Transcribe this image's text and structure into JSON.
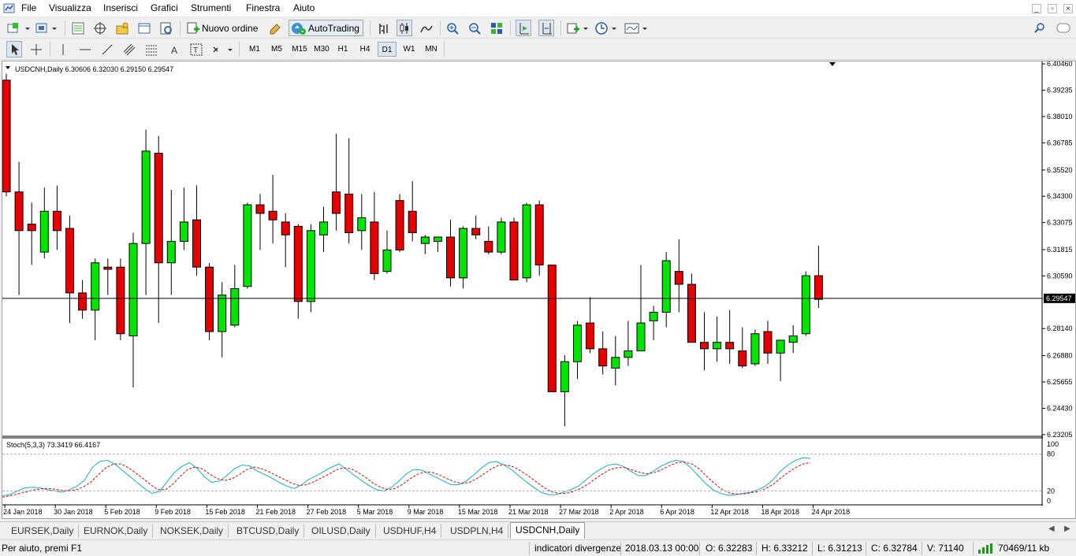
{
  "menu": [
    "File",
    "Visualizza",
    "Inserisci",
    "Grafici",
    "Strumenti",
    "Finestra",
    "Aiuto"
  ],
  "toolbar": {
    "new_order": "Nuovo ordine",
    "autotrading": "AutoTrading"
  },
  "timeframes": [
    "M1",
    "M5",
    "M15",
    "M30",
    "H1",
    "H4",
    "D1",
    "W1",
    "MN"
  ],
  "active_timeframe": "D1",
  "chart": {
    "header": "USDCNH,Daily  6.30606 6.32030 6.29150 6.29547",
    "price_labels": [
      "6.40460",
      "6.39235",
      "6.38010",
      "6.36785",
      "6.35520",
      "6.34300",
      "6.33075",
      "6.31815",
      "6.30590",
      "6.28140",
      "6.26880",
      "6.25655",
      "6.24430",
      "6.23205"
    ],
    "current_price": "6.29547",
    "indicator_header": "Stoch(5,3,3) 73.3419 66.4167",
    "indicator_levels": [
      "100",
      "80",
      "20",
      "0"
    ],
    "date_labels": [
      "24 Jan 2018",
      "30 Jan 2018",
      "5 Feb 2018",
      "9 Feb 2018",
      "15 Feb 2018",
      "21 Feb 2018",
      "27 Feb 2018",
      "5 Mar 2018",
      "9 Mar 2018",
      "15 Mar 2018",
      "21 Mar 2018",
      "27 Mar 2018",
      "2 Apr 2018",
      "6 Apr 2018",
      "12 Apr 2018",
      "18 Apr 2018",
      "24 Apr 2018"
    ],
    "colors": {
      "bull": "#00e600",
      "bear": "#e60000",
      "main": "#16b0c8",
      "signal": "#e00000"
    }
  },
  "chart_data": {
    "type": "candlestick",
    "symbol": "USDCNH",
    "timeframe": "Daily",
    "ylim": [
      6.232,
      6.405
    ],
    "candles": [
      {
        "o": 6.397,
        "h": 6.4,
        "l": 6.343,
        "c": 6.345
      },
      {
        "o": 6.345,
        "h": 6.359,
        "l": 6.297,
        "c": 6.327
      },
      {
        "o": 6.33,
        "h": 6.34,
        "l": 6.311,
        "c": 6.327
      },
      {
        "o": 6.317,
        "h": 6.347,
        "l": 6.314,
        "c": 6.336
      },
      {
        "o": 6.336,
        "h": 6.348,
        "l": 6.318,
        "c": 6.327
      },
      {
        "o": 6.328,
        "h": 6.334,
        "l": 6.284,
        "c": 6.298
      },
      {
        "o": 6.298,
        "h": 6.304,
        "l": 6.286,
        "c": 6.29
      },
      {
        "o": 6.29,
        "h": 6.314,
        "l": 6.276,
        "c": 6.312
      },
      {
        "o": 6.31,
        "h": 6.314,
        "l": 6.297,
        "c": 6.309
      },
      {
        "o": 6.31,
        "h": 6.314,
        "l": 6.276,
        "c": 6.279
      },
      {
        "o": 6.278,
        "h": 6.326,
        "l": 6.254,
        "c": 6.321
      },
      {
        "o": 6.321,
        "h": 6.374,
        "l": 6.297,
        "c": 6.364
      },
      {
        "o": 6.363,
        "h": 6.371,
        "l": 6.284,
        "c": 6.312
      },
      {
        "o": 6.312,
        "h": 6.346,
        "l": 6.297,
        "c": 6.322
      },
      {
        "o": 6.322,
        "h": 6.347,
        "l": 6.318,
        "c": 6.331
      },
      {
        "o": 6.332,
        "h": 6.348,
        "l": 6.306,
        "c": 6.31
      },
      {
        "o": 6.31,
        "h": 6.312,
        "l": 6.276,
        "c": 6.28
      },
      {
        "o": 6.28,
        "h": 6.303,
        "l": 6.268,
        "c": 6.297
      },
      {
        "o": 6.283,
        "h": 6.311,
        "l": 6.282,
        "c": 6.3
      },
      {
        "o": 6.301,
        "h": 6.34,
        "l": 6.3,
        "c": 6.339
      },
      {
        "o": 6.339,
        "h": 6.344,
        "l": 6.318,
        "c": 6.335
      },
      {
        "o": 6.336,
        "h": 6.353,
        "l": 6.321,
        "c": 6.332
      },
      {
        "o": 6.331,
        "h": 6.335,
        "l": 6.31,
        "c": 6.325
      },
      {
        "o": 6.329,
        "h": 6.33,
        "l": 6.286,
        "c": 6.294
      },
      {
        "o": 6.294,
        "h": 6.33,
        "l": 6.289,
        "c": 6.327
      },
      {
        "o": 6.325,
        "h": 6.338,
        "l": 6.317,
        "c": 6.331
      },
      {
        "o": 6.345,
        "h": 6.372,
        "l": 6.327,
        "c": 6.335
      },
      {
        "o": 6.344,
        "h": 6.37,
        "l": 6.321,
        "c": 6.326
      },
      {
        "o": 6.327,
        "h": 6.344,
        "l": 6.318,
        "c": 6.333
      },
      {
        "o": 6.331,
        "h": 6.345,
        "l": 6.304,
        "c": 6.307
      },
      {
        "o": 6.308,
        "h": 6.327,
        "l": 6.307,
        "c": 6.318
      },
      {
        "o": 6.341,
        "h": 6.344,
        "l": 6.317,
        "c": 6.318
      },
      {
        "o": 6.336,
        "h": 6.35,
        "l": 6.322,
        "c": 6.326
      },
      {
        "o": 6.321,
        "h": 6.325,
        "l": 6.316,
        "c": 6.324
      },
      {
        "o": 6.322,
        "h": 6.324,
        "l": 6.317,
        "c": 6.324
      },
      {
        "o": 6.324,
        "h": 6.332,
        "l": 6.301,
        "c": 6.305
      },
      {
        "o": 6.305,
        "h": 6.329,
        "l": 6.3,
        "c": 6.328
      },
      {
        "o": 6.328,
        "h": 6.334,
        "l": 6.323,
        "c": 6.325
      },
      {
        "o": 6.322,
        "h": 6.329,
        "l": 6.316,
        "c": 6.317
      },
      {
        "o": 6.317,
        "h": 6.333,
        "l": 6.316,
        "c": 6.331
      },
      {
        "o": 6.331,
        "h": 6.333,
        "l": 6.304,
        "c": 6.304
      },
      {
        "o": 6.305,
        "h": 6.34,
        "l": 6.303,
        "c": 6.339
      },
      {
        "o": 6.339,
        "h": 6.341,
        "l": 6.306,
        "c": 6.311
      },
      {
        "o": 6.311,
        "h": 6.311,
        "l": 6.252,
        "c": 6.252
      },
      {
        "o": 6.252,
        "h": 6.269,
        "l": 6.236,
        "c": 6.266
      },
      {
        "o": 6.266,
        "h": 6.285,
        "l": 6.258,
        "c": 6.283
      },
      {
        "o": 6.284,
        "h": 6.296,
        "l": 6.27,
        "c": 6.272
      },
      {
        "o": 6.272,
        "h": 6.28,
        "l": 6.26,
        "c": 6.264
      },
      {
        "o": 6.263,
        "h": 6.278,
        "l": 6.255,
        "c": 6.268
      },
      {
        "o": 6.268,
        "h": 6.285,
        "l": 6.264,
        "c": 6.271
      },
      {
        "o": 6.271,
        "h": 6.311,
        "l": 6.271,
        "c": 6.284
      },
      {
        "o": 6.285,
        "h": 6.292,
        "l": 6.276,
        "c": 6.289
      },
      {
        "o": 6.289,
        "h": 6.317,
        "l": 6.282,
        "c": 6.313
      },
      {
        "o": 6.308,
        "h": 6.323,
        "l": 6.289,
        "c": 6.302
      },
      {
        "o": 6.302,
        "h": 6.307,
        "l": 6.275,
        "c": 6.275
      },
      {
        "o": 6.275,
        "h": 6.289,
        "l": 6.262,
        "c": 6.272
      },
      {
        "o": 6.272,
        "h": 6.287,
        "l": 6.266,
        "c": 6.275
      },
      {
        "o": 6.275,
        "h": 6.29,
        "l": 6.265,
        "c": 6.272
      },
      {
        "o": 6.271,
        "h": 6.282,
        "l": 6.263,
        "c": 6.264
      },
      {
        "o": 6.265,
        "h": 6.281,
        "l": 6.264,
        "c": 6.279
      },
      {
        "o": 6.28,
        "h": 6.285,
        "l": 6.265,
        "c": 6.27
      },
      {
        "o": 6.27,
        "h": 6.276,
        "l": 6.257,
        "c": 6.276
      },
      {
        "o": 6.275,
        "h": 6.283,
        "l": 6.27,
        "c": 6.278
      },
      {
        "o": 6.279,
        "h": 6.308,
        "l": 6.278,
        "c": 6.306
      },
      {
        "o": 6.306,
        "h": 6.32,
        "l": 6.291,
        "c": 6.295
      }
    ],
    "stochastic": {
      "main": [
        12,
        14,
        20,
        25,
        26,
        25,
        22,
        20,
        18,
        22,
        28,
        38,
        58,
        68,
        70,
        64,
        54,
        44,
        34,
        24,
        16,
        19,
        35,
        50,
        60,
        66,
        57,
        43,
        34,
        36,
        45,
        56,
        62,
        61,
        53,
        47,
        41,
        34,
        28,
        24,
        30,
        39,
        45,
        52,
        59,
        64,
        55,
        46,
        37,
        29,
        22,
        20,
        26,
        36,
        48,
        55,
        54,
        48,
        42,
        36,
        30,
        30,
        36,
        46,
        57,
        66,
        68,
        63,
        55,
        45,
        35,
        26,
        18,
        14,
        14,
        18,
        22,
        28,
        38,
        48,
        56,
        62,
        64,
        60,
        52,
        45,
        45,
        52,
        60,
        66,
        70,
        68,
        58,
        45,
        32,
        22,
        16,
        13,
        14,
        16,
        18,
        22,
        28,
        38,
        52,
        62,
        70,
        74,
        73
      ],
      "signal": [
        10,
        12,
        15,
        18,
        21,
        23,
        24,
        23,
        21,
        20,
        22,
        27,
        35,
        47,
        58,
        64,
        64,
        58,
        49,
        40,
        30,
        22,
        22,
        31,
        44,
        55,
        59,
        56,
        47,
        40,
        37,
        40,
        47,
        55,
        59,
        56,
        51,
        45,
        39,
        33,
        29,
        30,
        35,
        41,
        47,
        54,
        58,
        56,
        50,
        42,
        33,
        26,
        22,
        24,
        31,
        40,
        47,
        51,
        50,
        46,
        40,
        35,
        32,
        34,
        40,
        48,
        56,
        62,
        62,
        59,
        52,
        44,
        35,
        26,
        19,
        16,
        16,
        19,
        24,
        31,
        40,
        48,
        55,
        58,
        58,
        54,
        50,
        48,
        50,
        55,
        61,
        66,
        67,
        64,
        56,
        44,
        33,
        23,
        17,
        15,
        15,
        17,
        19,
        24,
        31,
        41,
        50,
        58,
        64,
        66
      ]
    }
  },
  "tabs": [
    "EURSEK,Daily",
    "EURNOK,Daily",
    "NOKSEK,Daily",
    "BTCUSD,Daily",
    "OILUSD,Daily",
    "USDHUF,H4",
    "USDPLN,H4",
    "USDCNH,Daily"
  ],
  "active_tab": "USDCNH,Daily",
  "status": {
    "help": "Per aiuto, premi F1",
    "profile": "indicatori divergenze",
    "datetime": "2018.03.13 00:00",
    "open": "O: 6.32283",
    "high": "H: 6.33212",
    "low": "L: 6.31213",
    "close": "C: 6.32784",
    "volume": "V: 71140",
    "traffic": "70469/11 kb"
  }
}
